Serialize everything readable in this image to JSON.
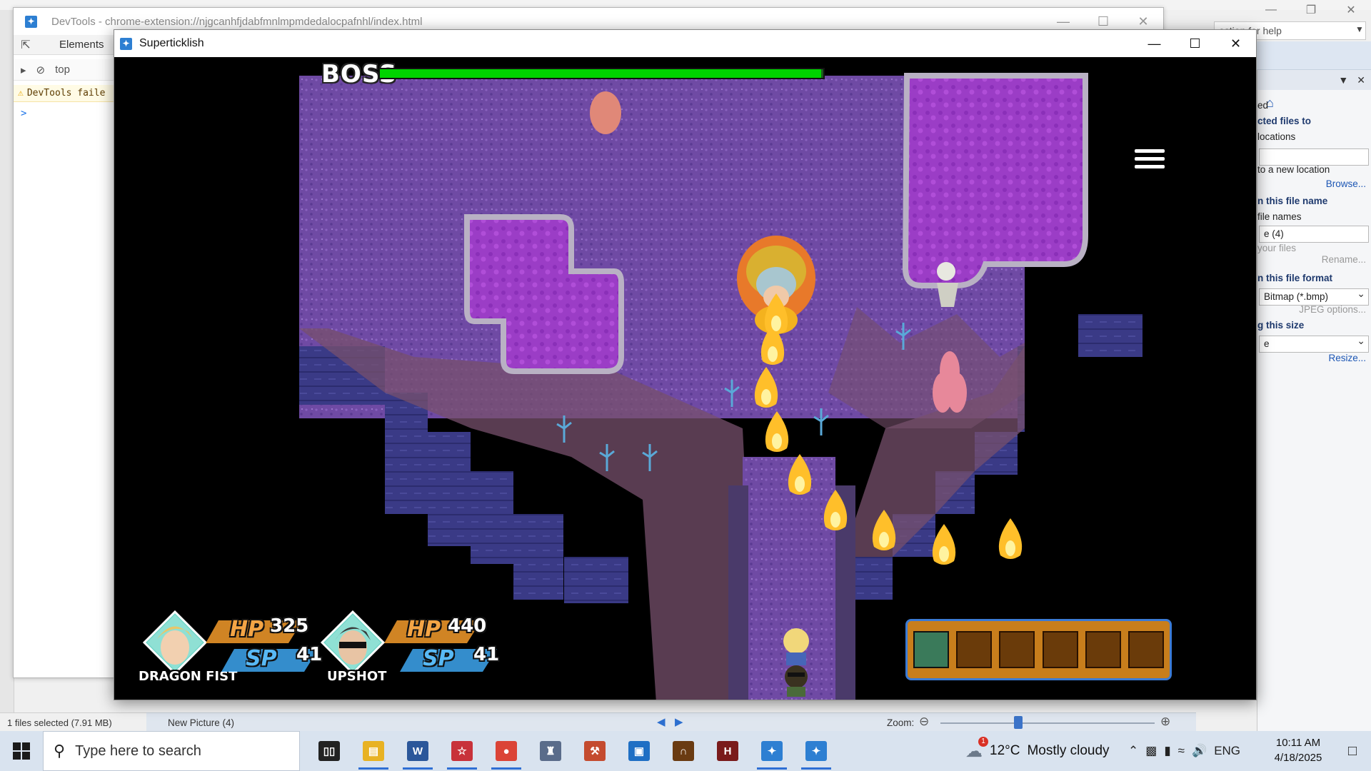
{
  "devtools": {
    "title": "DevTools - chrome-extension://njgcanhfjdabfmnlmpmdedalocpafnhl/index.html",
    "tab_elements": "Elements",
    "context": "top",
    "warning": "DevTools faile",
    "prompt": ">"
  },
  "paint": {
    "help_text": "estion for help",
    "panel": [
      {
        "text": "ed",
        "style": "plain"
      },
      {
        "text": "cted files to",
        "style": "h"
      },
      {
        "text": "locations",
        "style": "plain"
      },
      {
        "text": "",
        "style": "box"
      },
      {
        "text": "to a new location",
        "style": "plain"
      },
      {
        "text": "Browse...",
        "style": "link"
      },
      {
        "text": "n this file name",
        "style": "h"
      },
      {
        "text": "file names",
        "style": "plain"
      },
      {
        "text": "e (4)",
        "style": "box"
      },
      {
        "text": "your files",
        "style": "gray"
      },
      {
        "text": "Rename...",
        "style": "gray-right"
      },
      {
        "text": "n this file format",
        "style": "h"
      },
      {
        "text": "Bitmap (*.bmp)",
        "style": "select"
      },
      {
        "text": "JPEG options...",
        "style": "gray-right"
      },
      {
        "text": "g this size",
        "style": "h"
      },
      {
        "text": "e",
        "style": "select"
      },
      {
        "text": "Resize...",
        "style": "link"
      }
    ],
    "status_selected": "1 files selected (7.91 MB)",
    "status_file": "New Picture (4)",
    "zoom_label": "Zoom:"
  },
  "game": {
    "window_title": "Superticklish",
    "boss_label": "BOSS",
    "boss_hp_fraction": 0.995,
    "party": [
      {
        "name": "DRAGON FIST",
        "hp_label": "HP",
        "hp": "325",
        "sp_label": "SP",
        "sp": "41",
        "hair": "#e9c66a",
        "skin": "#f2d0b0"
      },
      {
        "name": "UPSHOT",
        "hp_label": "HP",
        "hp": "440",
        "sp_label": "SP",
        "sp": "41",
        "hair": "#3a3a3a",
        "skin": "#e8c4a4"
      }
    ],
    "hotbar_slots": 6,
    "hotbar_active": 0,
    "colors": {
      "void": "#000000",
      "floor_dark": "#3a3a86",
      "floor_pattern": "#6f4aa4",
      "ledge": "#77506c",
      "pool": "#9b3dc6",
      "pool_border": "#b9b1c4",
      "fire": "#ffbf2a",
      "boss_bar": "#00d400"
    }
  },
  "taskbar": {
    "search_placeholder": "Type here to search",
    "apps": [
      {
        "icon": "task-view-icon",
        "glyph": "▯▯",
        "color": "#222222",
        "running": false
      },
      {
        "icon": "file-explorer-icon",
        "glyph": "▤",
        "color": "#e8b223",
        "running": true
      },
      {
        "icon": "word-icon",
        "glyph": "W",
        "color": "#2b579a",
        "running": true
      },
      {
        "icon": "image-editor-icon",
        "glyph": "☆",
        "color": "#c8323a",
        "running": true
      },
      {
        "icon": "chrome-icon",
        "glyph": "●",
        "color": "#db4437",
        "running": true
      },
      {
        "icon": "game-maker-icon",
        "glyph": "♜",
        "color": "#5a6c8a",
        "running": false
      },
      {
        "icon": "tool-icon",
        "glyph": "⚒",
        "color": "#c44b2f",
        "running": false
      },
      {
        "icon": "window-app-icon",
        "glyph": "▣",
        "color": "#1f6fc4",
        "running": false
      },
      {
        "icon": "dungeon-app-icon",
        "glyph": "∩",
        "color": "#6a3b12",
        "running": false
      },
      {
        "icon": "rpg-app-icon",
        "glyph": "H",
        "color": "#7a1b1b",
        "running": false
      },
      {
        "icon": "nwjs-app-icon",
        "glyph": "✦",
        "color": "#2d7fd2",
        "running": true
      },
      {
        "icon": "nwjs-app-2-icon",
        "glyph": "✦",
        "color": "#2d7fd2",
        "running": true
      }
    ],
    "weather_temp": "12°C",
    "weather_desc": "Mostly cloudy",
    "weather_badge": "1",
    "lang": "ENG",
    "time": "10:11 AM",
    "date": "4/18/2025"
  }
}
